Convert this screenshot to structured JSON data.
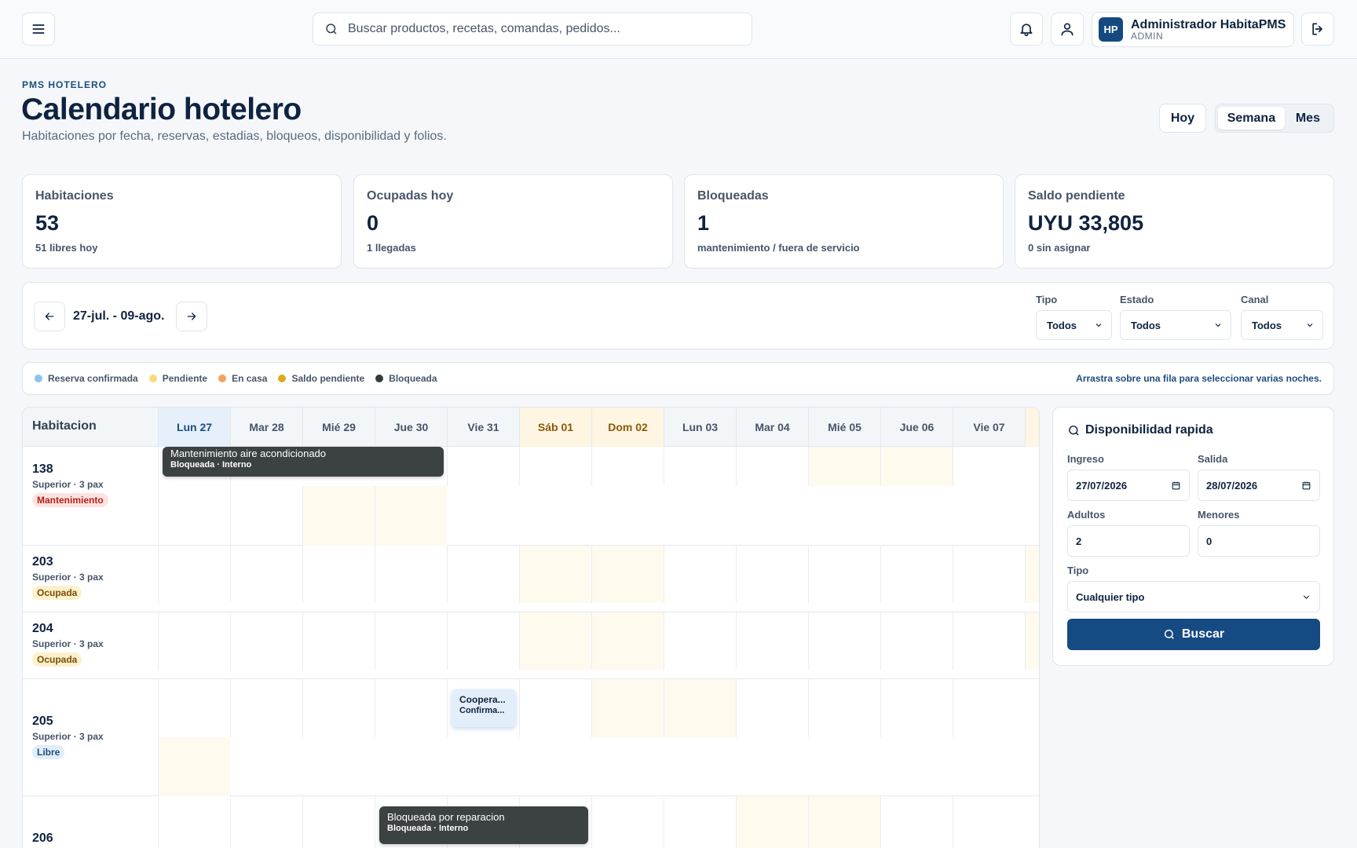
{
  "topbar": {
    "search_placeholder": "Buscar productos, recetas, comandas, pedidos...",
    "user": {
      "initials": "HP",
      "name": "Administrador HabitaPMS",
      "role": "ADMIN"
    }
  },
  "header": {
    "eyebrow": "PMS HOTELERO",
    "title": "Calendario hotelero",
    "subtitle": "Habitaciones por fecha, reservas, estadias, bloqueos, disponibilidad y folios.",
    "today_button": "Hoy",
    "views": [
      "Semana",
      "Mes"
    ],
    "active_view": "Semana"
  },
  "kpis": [
    {
      "label": "Habitaciones",
      "value": "53",
      "note": "51 libres hoy"
    },
    {
      "label": "Ocupadas hoy",
      "value": "0",
      "note": "1 llegadas"
    },
    {
      "label": "Bloqueadas",
      "value": "1",
      "note": "mantenimiento / fuera de servicio"
    },
    {
      "label": "Saldo pendiente",
      "value": "UYU 33,805",
      "note": "0 sin asignar"
    }
  ],
  "range": {
    "label": "27-jul. - 09-ago.",
    "filters": [
      {
        "label": "Tipo",
        "value": "Todos"
      },
      {
        "label": "Estado",
        "value": "Todos"
      },
      {
        "label": "Canal",
        "value": "Todos"
      }
    ]
  },
  "legend": {
    "items": [
      {
        "label": "Reserva confirmada",
        "color": "#8cc3ee"
      },
      {
        "label": "Pendiente",
        "color": "#fcd97a"
      },
      {
        "label": "En casa",
        "color": "#f4a261"
      },
      {
        "label": "Saldo pendiente",
        "color": "#e0a91b"
      },
      {
        "label": "Bloqueada",
        "color": "#333b3b"
      }
    ],
    "hint": "Arrastra sobre una fila para seleccionar varias noches."
  },
  "calendar": {
    "corner": "Habitacion",
    "days": [
      "Lun 27",
      "Mar 28",
      "Mié 29",
      "Jue 30",
      "Vie 31",
      "Sáb 01",
      "Dom 02",
      "Lun 03",
      "Mar 04",
      "Mié 05",
      "Jue 06",
      "Vie 07"
    ],
    "rooms": [
      {
        "number": "138",
        "type": "Superior · 3 pax",
        "status": "Mantenimiento",
        "status_color": "red"
      },
      {
        "number": "203",
        "type": "Superior · 3 pax",
        "status": "Ocupada",
        "status_color": "amber"
      },
      {
        "number": "204",
        "type": "Superior · 3 pax",
        "status": "Ocupada",
        "status_color": "amber"
      },
      {
        "number": "205",
        "type": "Superior · 3 pax",
        "status": "Libre",
        "status_color": "blue"
      },
      {
        "number": "206",
        "type": "",
        "status": "",
        "status_color": ""
      }
    ],
    "events": [
      {
        "title": "Mantenimiento aire acondicionado",
        "subtitle": "Bloqueada · Interno",
        "style": "dark"
      },
      {
        "title": "Coopera...",
        "subtitle": "Confirma...",
        "style": "light"
      },
      {
        "title": "Bloqueada por reparacion",
        "subtitle": "Bloqueada · Interno",
        "style": "dark"
      }
    ]
  },
  "availability": {
    "title": "Disponibilidad rapida",
    "checkin_label": "Ingreso",
    "checkin_value": "27/07/2026",
    "checkout_label": "Salida",
    "checkout_value": "28/07/2026",
    "adults_label": "Adultos",
    "adults_value": "2",
    "children_label": "Menores",
    "children_value": "0",
    "type_label": "Tipo",
    "type_value": "Cualquier tipo",
    "search_button": "Buscar"
  }
}
